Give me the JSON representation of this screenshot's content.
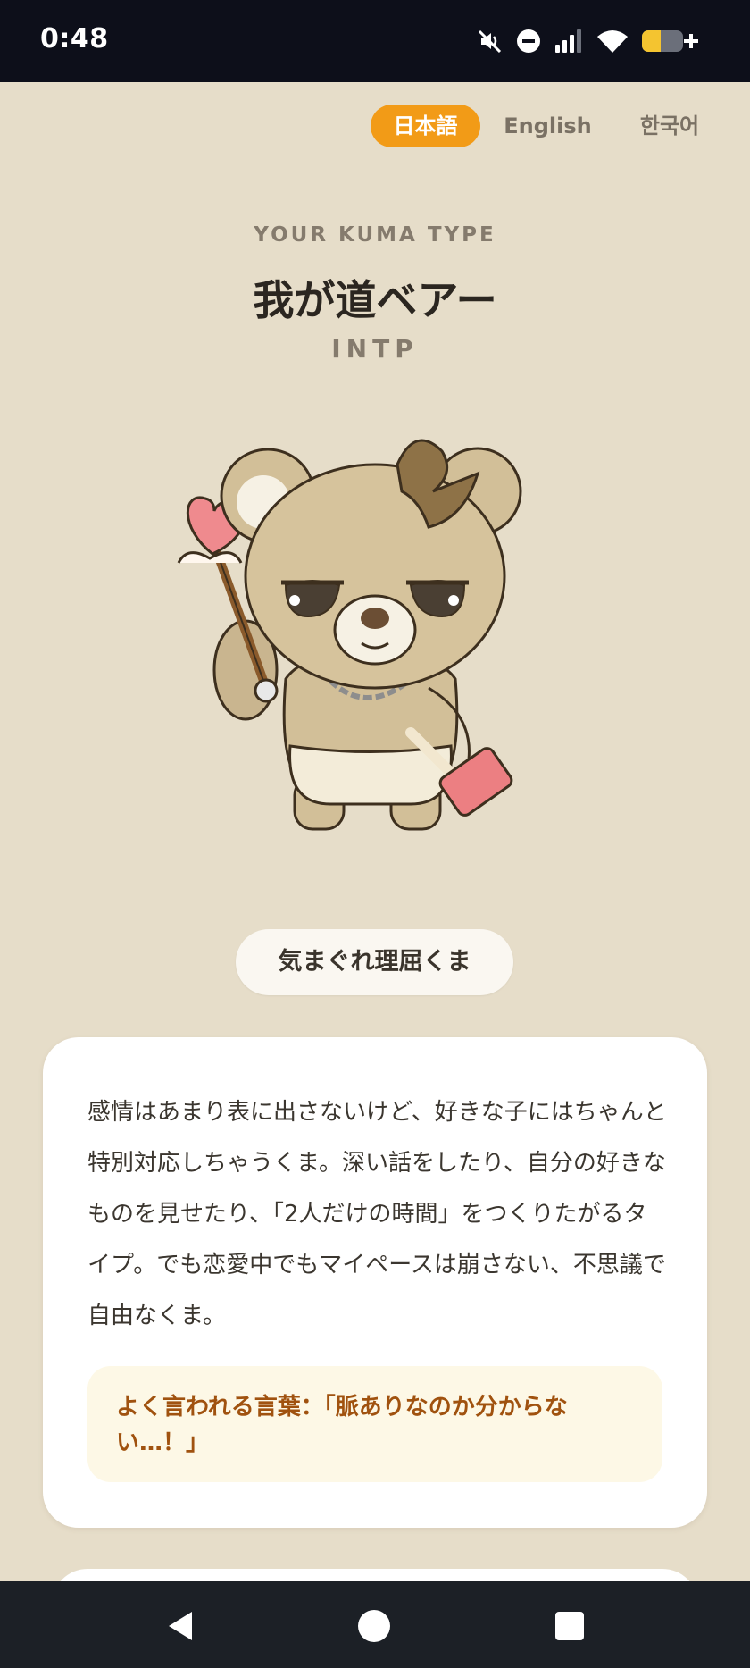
{
  "status_bar": {
    "time": "0:48",
    "icons": [
      "mute-icon",
      "do-not-disturb-icon",
      "signal-icon",
      "wifi-icon",
      "battery-charging-icon"
    ],
    "battery_color": "#f4c430"
  },
  "languages": [
    {
      "label": "日本語",
      "active": true
    },
    {
      "label": "English",
      "active": false
    },
    {
      "label": "한국어",
      "active": false
    }
  ],
  "result": {
    "kicker": "YOUR KUMA TYPE",
    "title": "我が道ベアー",
    "code": "INTP",
    "nickname": "気まぐれ理屈くま"
  },
  "description": {
    "body": "感情はあまり表に出さないけど、好きな子にはちゃんと特別対応しちゃうくま。深い話をしたり、自分の好きなものを見せたり、「2人だけの時間」をつくりたがるタイプ。でも恋愛中でもマイペースは崩さない、不思議で自由なくま。",
    "quote": "よく言われる言葉：「脈ありなのか分からない…！」"
  },
  "colors": {
    "background": "#e6ddc9",
    "accent": "#f29b17",
    "quote_text": "#a0520f",
    "quote_bg": "#fdf8e6"
  },
  "nav": {
    "icons": [
      "back-icon",
      "home-icon",
      "recents-icon"
    ]
  }
}
